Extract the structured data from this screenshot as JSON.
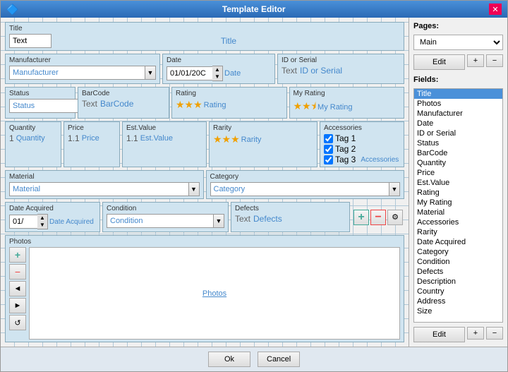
{
  "window": {
    "title": "Template Editor",
    "icon": "🔷"
  },
  "pages": {
    "label": "Pages:",
    "selected": "Main",
    "options": [
      "Main"
    ],
    "edit_btn": "Edit",
    "add_btn": "+",
    "del_btn": "−"
  },
  "fields": {
    "label": "Fields:",
    "items": [
      "Title",
      "Photos",
      "Manufacturer",
      "Date",
      "ID or Serial",
      "Status",
      "BarCode",
      "Quantity",
      "Price",
      "Est.Value",
      "Rating",
      "My Rating",
      "Material",
      "Accessories",
      "Rarity",
      "Date Acquired",
      "Category",
      "Condition",
      "Defects",
      "Description",
      "Country",
      "Address",
      "Size"
    ],
    "selected_index": 0,
    "edit_btn": "Edit",
    "add_btn": "+",
    "del_btn": "−"
  },
  "form": {
    "title_label": "Title",
    "title_value": "Text",
    "title_placeholder": "Title",
    "manufacturer_label": "Manufacturer",
    "manufacturer_value": "Manufacturer",
    "date_label": "Date",
    "date_value": "01/01/20C",
    "date_placeholder": "Date",
    "id_label": "ID or Serial",
    "id_text": "Text",
    "id_placeholder": "ID or Serial",
    "status_label": "Status",
    "status_value": "Status",
    "barcode_label": "BarCode",
    "barcode_text": "Text",
    "barcode_placeholder": "BarCode",
    "rating_label": "Rating",
    "rating_stars": 3,
    "rating_placeholder": "Rating",
    "myrating_label": "My Rating",
    "myrating_stars": 2,
    "myrating_half": true,
    "myrating_placeholder": "My Rating",
    "quantity_label": "Quantity",
    "quantity_value": "1",
    "quantity_placeholder": "Quantity",
    "price_label": "Price",
    "price_value": "1.1",
    "price_placeholder": "Price",
    "estval_label": "Est.Value",
    "estval_value": "1.1",
    "estval_placeholder": "Est.Value",
    "rarity_label": "Rarity",
    "rarity_stars": 3,
    "rarity_placeholder": "Rarity",
    "accessories_label": "Accessories",
    "accessories_tags": [
      "Tag 1",
      "Tag 2",
      "Tag 3"
    ],
    "accessories_link": "Accessories",
    "material_label": "Material",
    "material_value": "Material",
    "category_label": "Category",
    "category_value": "Category",
    "dateacq_label": "Date Acquired",
    "dateacq_value": "01/",
    "dateacq_placeholder": "Date Acquired",
    "condition_label": "Condition",
    "condition_value": "Condition",
    "defects_label": "Defects",
    "defects_text": "Text",
    "defects_placeholder": "Defects",
    "photos_label": "Photos",
    "photos_link": "Photos"
  },
  "footer": {
    "ok_btn": "Ok",
    "cancel_btn": "Cancel"
  }
}
